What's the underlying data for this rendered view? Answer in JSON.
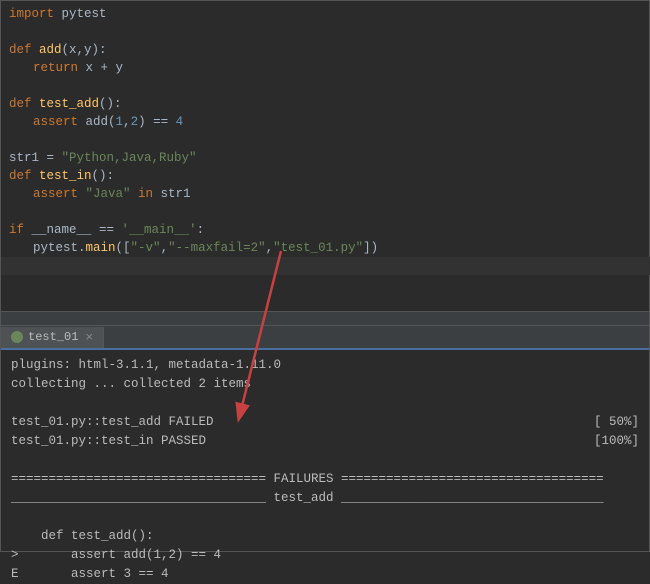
{
  "code": {
    "l1_kw": "import",
    "l1_mod": " pytest",
    "l3_kw": "def ",
    "l3_fn": "add",
    "l3_params": "(x,y):",
    "l4_kw": "return ",
    "l4_expr": "x + y",
    "l6_kw": "def ",
    "l6_fn": "test_add",
    "l6_params": "():",
    "l7_kw": "assert ",
    "l7_call": "add(",
    "l7_n1": "1",
    "l7_comma": ",",
    "l7_n2": "2",
    "l7_close": ") == ",
    "l7_n3": "4",
    "l9_var": "str1 = ",
    "l9_str": "\"Python,Java,Ruby\"",
    "l10_kw": "def ",
    "l10_fn": "test_in",
    "l10_params": "():",
    "l11_kw": "assert ",
    "l11_str": "\"Java\"",
    "l11_in": " in ",
    "l11_var": "str1",
    "l13_kw": "if ",
    "l13_name": "__name__",
    "l13_eq": " == ",
    "l13_main": "'__main__'",
    "l13_colon": ":",
    "l14_obj": "pytest.",
    "l14_fn": "main",
    "l14_open": "([",
    "l14_s1": "\"-v\"",
    "l14_c1": ",",
    "l14_s2": "\"--maxfail=2\"",
    "l14_c2": ",",
    "l14_s3": "\"test_01.py\"",
    "l14_close": "])"
  },
  "tab": {
    "label": "test_01",
    "close": "×"
  },
  "term": {
    "plugins": "plugins: html-3.1.1, metadata-1.11.0",
    "collecting": "collecting ... collected 2 items",
    "r1": "test_01.py::test_add FAILED",
    "r1p": "[ 50%]",
    "r2": "test_01.py::test_in PASSED",
    "r2p": "[100%]",
    "fail_hdr": "================================== FAILURES ===================================",
    "test_hdr": "__________________________________ test_add ___________________________________",
    "d1": "    def test_add():",
    "d2": ">       assert add(1,2) == 4",
    "d3": "E       assert 3 == 4"
  }
}
